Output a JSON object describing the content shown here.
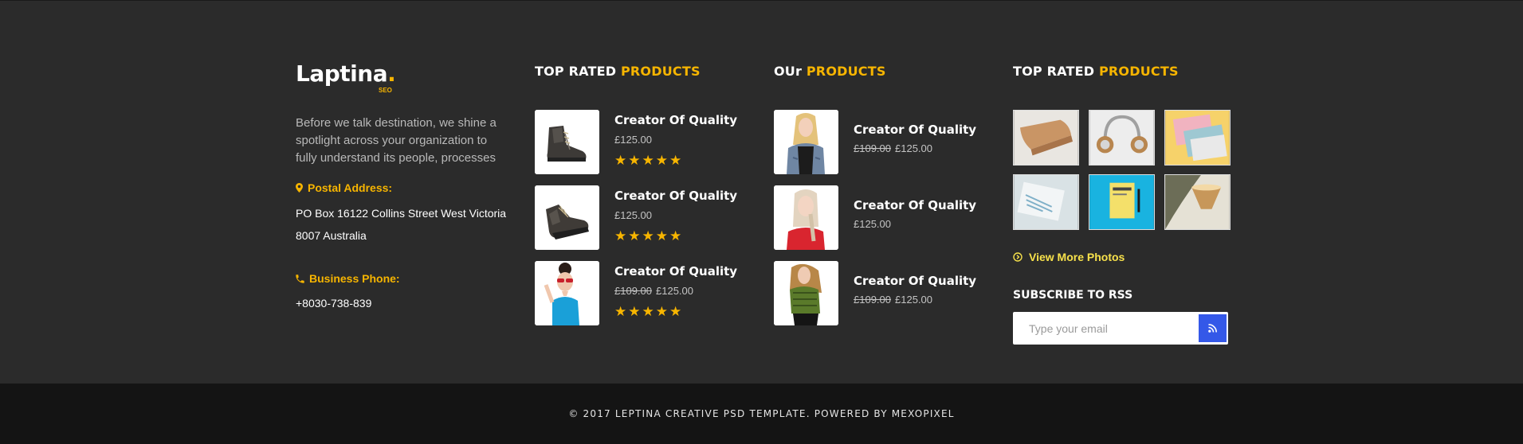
{
  "about": {
    "logo_text": "Laptina",
    "logo_dot": ".",
    "logo_sub": "SEO",
    "description": "Before we talk destination, we shine a spotlight across your organization to fully understand its people, processes",
    "address_label": "Postal Address:",
    "address_line1": "PO Box 16122 Collins Street West Victoria",
    "address_line2": "8007 Australia",
    "phone_label": "Business Phone:",
    "phone_value": "+8030-738-839"
  },
  "top_rated": {
    "title_main": "TOP RATED",
    "title_accent": "PRODUCTS",
    "products": [
      {
        "name": "Creator Of Quality",
        "old_price": "",
        "price": "£125.00",
        "rating": 5,
        "image": "boot-icon"
      },
      {
        "name": "Creator Of Quality",
        "old_price": "",
        "price": "£125.00",
        "rating": 5,
        "image": "boot-icon"
      },
      {
        "name": "Creator Of Quality",
        "old_price": "£109.00",
        "price": "£125.00",
        "rating": 5,
        "image": "woman-sunglasses-photo"
      }
    ]
  },
  "our_products": {
    "title_main": "OUr",
    "title_accent": "PRODUCTS",
    "products": [
      {
        "name": "Creator Of Quality",
        "old_price": "£109.00",
        "price": "£125.00",
        "image": "woman-denim-photo"
      },
      {
        "name": "Creator Of Quality",
        "old_price": "",
        "price": "£125.00",
        "image": "woman-red-top-photo"
      },
      {
        "name": "Creator Of Quality",
        "old_price": "£109.00",
        "price": "£125.00",
        "image": "woman-green-shirt-photo"
      }
    ]
  },
  "gallery": {
    "title_main": "TOP RATED",
    "title_accent": "PRODUCTS",
    "tiles": [
      "wood-block-photo",
      "headphones-photo",
      "business-cards-photo",
      "paper-documents-photo",
      "yellow-brochure-photo",
      "lamp-photo"
    ],
    "more_label": "View More Photos",
    "rss_title": "SUBSCRIBE TO RSS",
    "rss_placeholder": "Type your email"
  },
  "footer": {
    "copyright": "© 2017 LEPTINA CREATIVE PSD TEMPLATE. POWERED BY MEXOPIXEL"
  },
  "colors": {
    "accent": "#f7b500",
    "link": "#f7e14b",
    "button": "#3458e8",
    "background": "#2b2b2b",
    "bottom_bar": "#141414"
  }
}
